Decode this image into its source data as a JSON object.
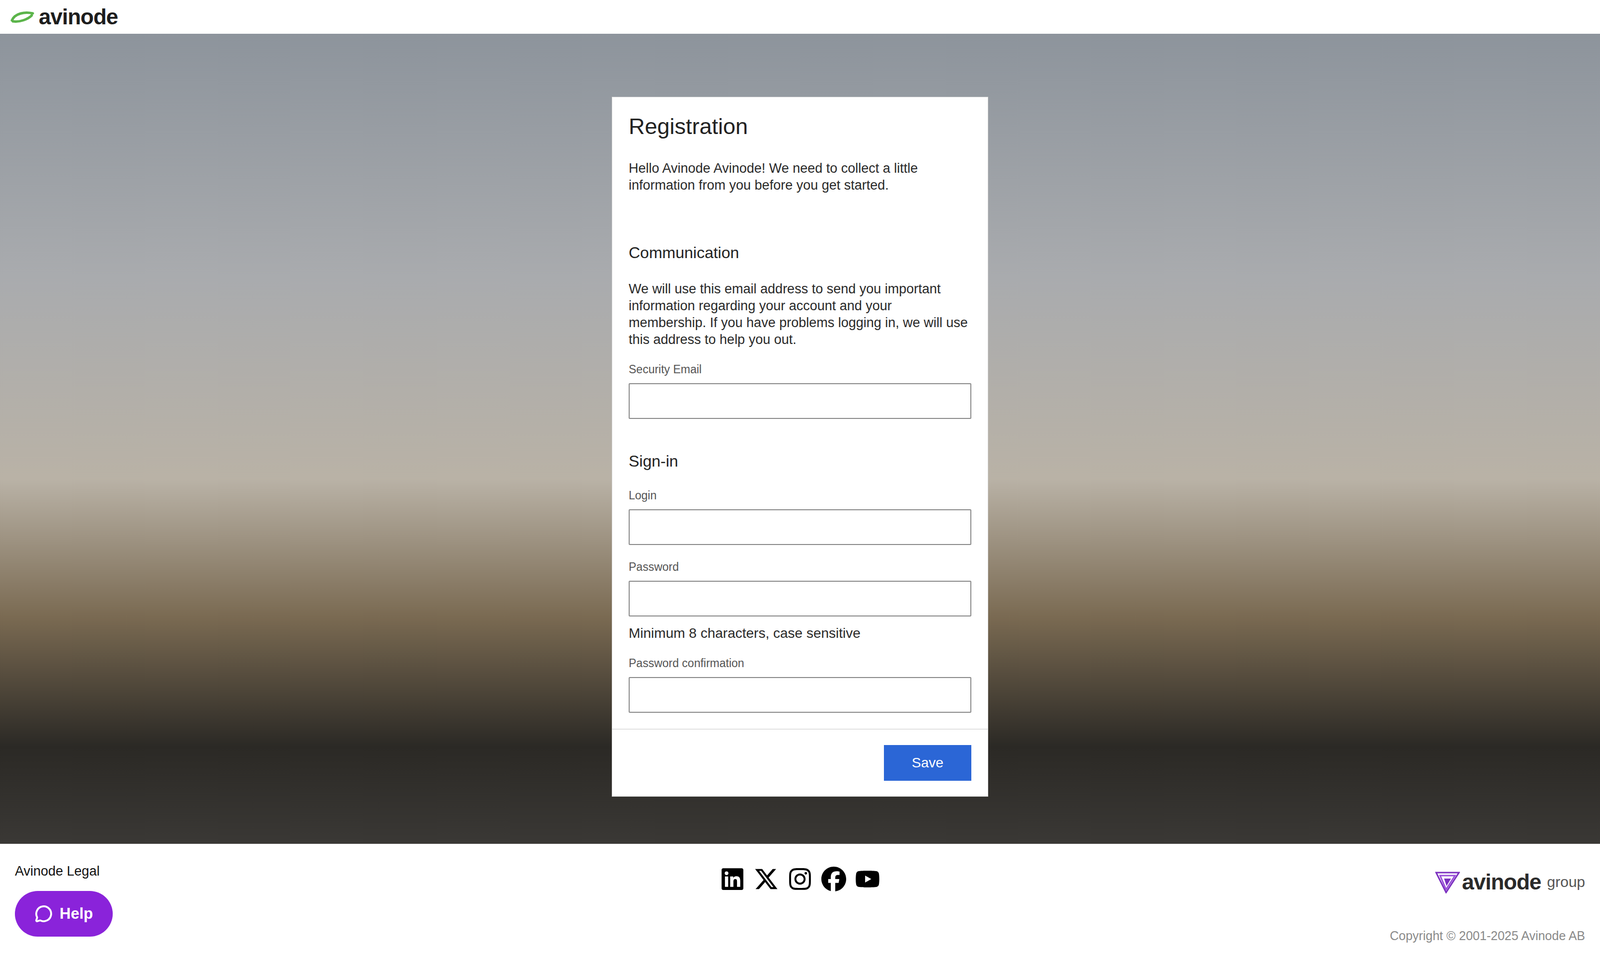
{
  "header": {
    "logo": "avinode"
  },
  "form": {
    "title": "Registration",
    "greeting": "Hello Avinode Avinode! We need to collect a little information from you before you get started.",
    "sections": [
      {
        "title": "Communication",
        "description": "We will use this email address to send you important information regarding your account and your membership. If you have problems logging in, we will use this address to help you out.",
        "fields": [
          {
            "label": "Security Email",
            "kind": "email",
            "hint": ""
          }
        ]
      },
      {
        "title": "Sign-in",
        "description": "",
        "fields": [
          {
            "label": "Login",
            "kind": "text",
            "hint": ""
          },
          {
            "label": "Password",
            "kind": "password",
            "hint": "Minimum 8 characters, case sensitive"
          },
          {
            "label": "Password confirmation",
            "kind": "password",
            "hint": ""
          }
        ]
      }
    ],
    "buttons": [
      "Save"
    ]
  },
  "footer": {
    "legal": "Avinode Legal",
    "help": "Help",
    "group_logo": {
      "brand": "avinode",
      "suffix": "group"
    },
    "copyright": "Copyright © 2001-2025 Avinode AB"
  }
}
